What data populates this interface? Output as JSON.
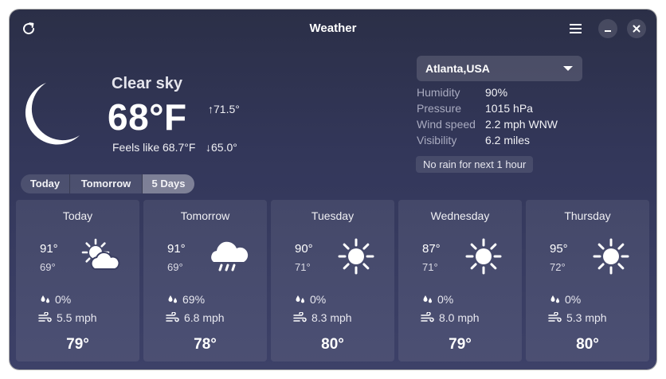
{
  "window": {
    "title": "Weather"
  },
  "icons": {
    "refresh": "refresh-icon",
    "menu": "hamburger-menu-icon",
    "minimize": "minimize-icon",
    "close": "close-icon",
    "current_condition": "moon-icon",
    "dropdown": "chevron-down-icon"
  },
  "current": {
    "condition": "Clear sky",
    "temperature": "68°F",
    "high": "↑71.5°",
    "low": "↓65.0°",
    "feels_like": "Feels like 68.7°F"
  },
  "location": {
    "selected": "Atlanta,USA"
  },
  "details": [
    {
      "label": "Humidity",
      "value": "90%"
    },
    {
      "label": "Pressure",
      "value": "1015 hPa"
    },
    {
      "label": "Wind speed",
      "value": "2.2 mph WNW"
    },
    {
      "label": "Visibility",
      "value": "6.2 miles"
    }
  ],
  "rain_forecast": "No rain for next 1 hour",
  "tabs": [
    {
      "label": "Today",
      "active": false
    },
    {
      "label": "Tomorrow",
      "active": false
    },
    {
      "label": "5 Days",
      "active": true
    }
  ],
  "forecast": [
    {
      "day": "Today",
      "high": "91°",
      "low": "69°",
      "icon": "partly-cloudy-icon",
      "rain": "0%",
      "wind": "5.5 mph",
      "feels": "79°"
    },
    {
      "day": "Tomorrow",
      "high": "91°",
      "low": "69°",
      "icon": "rain-cloud-icon",
      "rain": "69%",
      "wind": "6.8 mph",
      "feels": "78°"
    },
    {
      "day": "Tuesday",
      "high": "90°",
      "low": "71°",
      "icon": "sun-icon",
      "rain": "0%",
      "wind": "8.3 mph",
      "feels": "80°"
    },
    {
      "day": "Wednesday",
      "high": "87°",
      "low": "71°",
      "icon": "sun-icon",
      "rain": "0%",
      "wind": "8.0 mph",
      "feels": "79°"
    },
    {
      "day": "Thursday",
      "high": "95°",
      "low": "72°",
      "icon": "sun-icon",
      "rain": "0%",
      "wind": "5.3 mph",
      "feels": "80°"
    }
  ],
  "colors": {
    "window_bg_top": "#2b2f47",
    "window_bg_bottom": "#3d4168",
    "text_primary": "#ffffff",
    "text_secondary": "#a9abc0"
  }
}
